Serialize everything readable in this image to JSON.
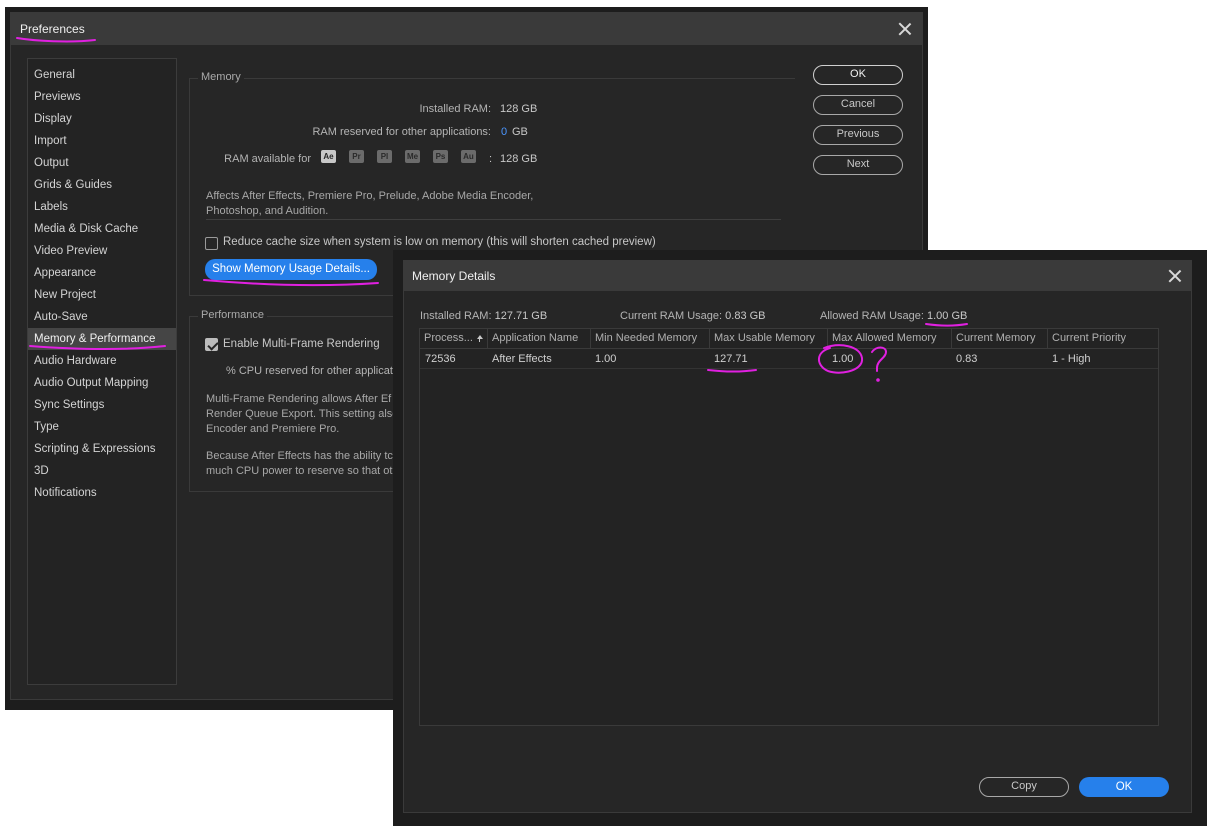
{
  "preferences": {
    "title": "Preferences",
    "sidebar": [
      {
        "label": "General"
      },
      {
        "label": "Previews"
      },
      {
        "label": "Display"
      },
      {
        "label": "Import"
      },
      {
        "label": "Output"
      },
      {
        "label": "Grids & Guides"
      },
      {
        "label": "Labels"
      },
      {
        "label": "Media & Disk Cache"
      },
      {
        "label": "Video Preview"
      },
      {
        "label": "Appearance"
      },
      {
        "label": "New Project"
      },
      {
        "label": "Auto-Save"
      },
      {
        "label": "Memory & Performance",
        "selected": true
      },
      {
        "label": "Audio Hardware"
      },
      {
        "label": "Audio Output Mapping"
      },
      {
        "label": "Sync Settings"
      },
      {
        "label": "Type"
      },
      {
        "label": "Scripting & Expressions"
      },
      {
        "label": "3D"
      },
      {
        "label": "Notifications"
      }
    ],
    "memory": {
      "legend": "Memory",
      "installed_ram_label": "Installed RAM:",
      "installed_ram_value": "128 GB",
      "reserved_label": "RAM reserved for other applications:",
      "reserved_value": "0",
      "reserved_unit": "GB",
      "available_label": "RAM available for",
      "apps": [
        "Ae",
        "Pr",
        "Pl",
        "Me",
        "Ps",
        "Au"
      ],
      "available_sep": ":",
      "available_value": "128 GB",
      "note_line1": "Affects After Effects, Premiere Pro, Prelude, Adobe Media Encoder,",
      "note_line2": "Photoshop, and Audition.",
      "reduce_cache_label": "Reduce cache size when system is low on memory (this will shorten cached preview)",
      "reduce_cache_checked": false,
      "show_details_button": "Show Memory Usage Details..."
    },
    "performance": {
      "legend": "Performance",
      "mfr_label": "Enable Multi-Frame Rendering",
      "mfr_checked": true,
      "cpu_reserved_label": "% CPU reserved for other applicat",
      "para1": [
        "Multi-Frame Rendering allows After Ef",
        "Render Queue Export. This setting also",
        "Encoder and Premiere Pro."
      ],
      "para2": [
        "Because After Effects has the ability tc",
        "much CPU power to reserve so that ot"
      ]
    },
    "buttons": {
      "ok": "OK",
      "cancel": "Cancel",
      "previous": "Previous",
      "next": "Next"
    }
  },
  "memory_details": {
    "title": "Memory Details",
    "installed_ram_label": "Installed RAM:",
    "installed_ram_value": "127.71 GB",
    "current_usage_label": "Current RAM Usage:",
    "current_usage_value": "0.83 GB",
    "allowed_usage_label": "Allowed RAM Usage:",
    "allowed_usage_value": "1.00 GB",
    "columns": [
      "Process...",
      "Application Name",
      "Min Needed Memory",
      "Max Usable Memory",
      "Max Allowed Memory",
      "Current Memory",
      "Current Priority"
    ],
    "rows": [
      {
        "process": "72536",
        "app": "After Effects",
        "min_needed": "1.00",
        "max_usable": "127.71",
        "max_allowed": "1.00",
        "current": "0.83",
        "priority": "1 - High"
      }
    ],
    "buttons": {
      "copy": "Copy",
      "ok": "OK"
    }
  },
  "annotation": {
    "color": "#e020e0",
    "question_mark": "?"
  }
}
